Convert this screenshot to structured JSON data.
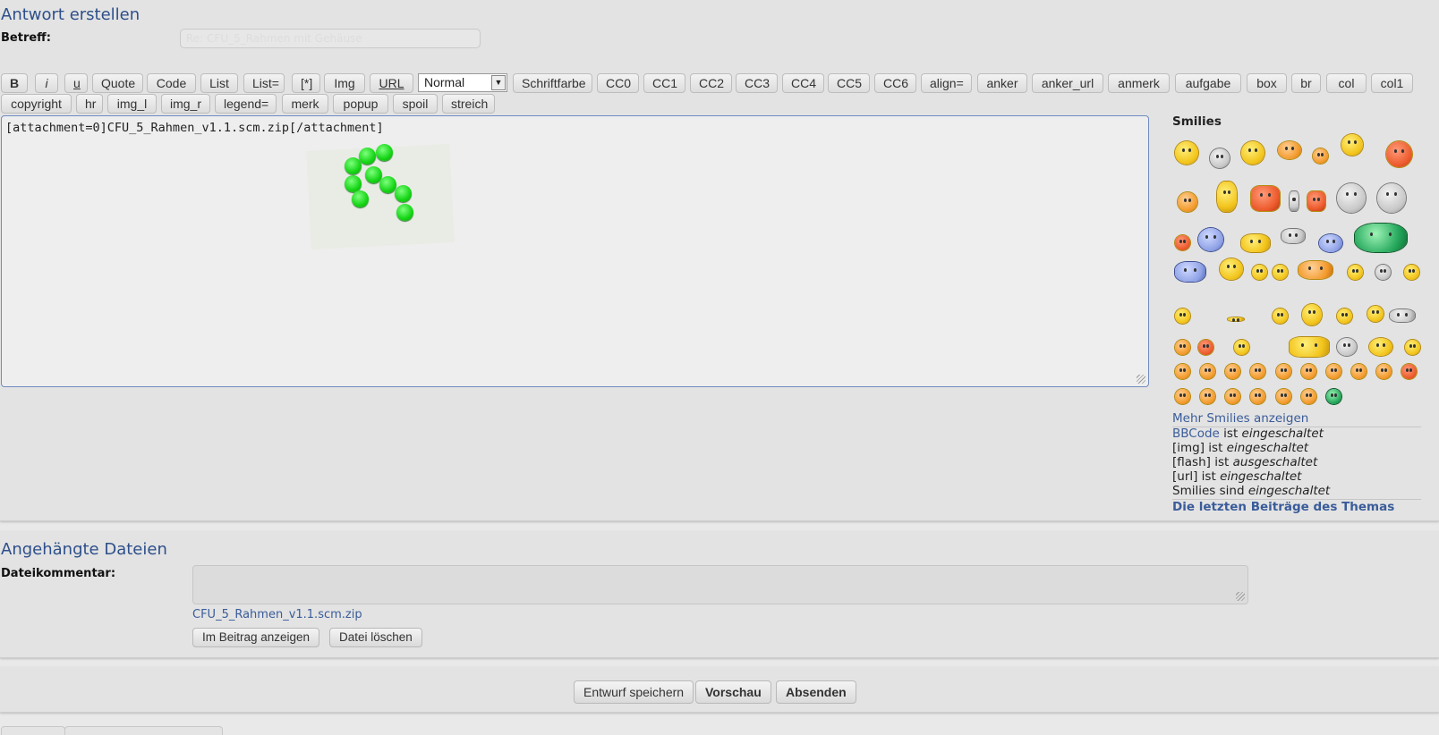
{
  "post": {
    "heading": "Antwort erstellen",
    "subject_label": "Betreff:",
    "subject_value": "Re: CFU_5_Rahmen mit Gehäuse"
  },
  "toolbar": {
    "buttons": [
      "B",
      "i",
      "u",
      "Quote",
      "Code",
      "List",
      "List=",
      "[*]",
      "Img",
      "URL"
    ],
    "font_size": "Normal",
    "buttons2": [
      "Schriftfarbe",
      "CC0",
      "CC1",
      "CC2",
      "CC3",
      "CC4",
      "CC5",
      "CC6",
      "align=",
      "anker",
      "anker_url",
      "anmerk",
      "aufgabe",
      "box",
      "br",
      "col",
      "col1"
    ],
    "row2": [
      "copyright",
      "hr",
      "img_l",
      "img_r",
      "legend=",
      "merk",
      "popup",
      "spoil",
      "streich"
    ]
  },
  "editor": {
    "content": "[attachment=0]CFU_5_Rahmen_v1.1.scm.zip[/attachment]"
  },
  "sidebar": {
    "smilies_title": "Smilies",
    "more_smilies": "Mehr Smilies anzeigen",
    "bbcode_link": "BBCode",
    "bbcode_rest": "ist",
    "bbcode_state": "eingeschaltet",
    "img_pre": "[img] ist",
    "img_state": "eingeschaltet",
    "flash_pre": "[flash] ist",
    "flash_state": "ausgeschaltet",
    "url_pre": "[url] ist",
    "url_state": "eingeschaltet",
    "smilies_pre": "Smilies sind",
    "smilies_state": "eingeschaltet",
    "last_posts": "Die letzten Beiträge des Themas"
  },
  "attachments": {
    "heading": "Angehängte Dateien",
    "comment_label": "Dateikommentar:",
    "file_name": "CFU_5_Rahmen_v1.1.scm.zip",
    "show_in_post": "Im Beitrag anzeigen",
    "delete_file": "Datei löschen"
  },
  "actions": {
    "save_draft": "Entwurf speichern",
    "preview": "Vorschau",
    "submit": "Absenden"
  },
  "colors": {
    "link": "#3a5c9a",
    "heading": "#2d4f8a",
    "editor_border": "#6f8cc1",
    "pasted_dots": "#14d414"
  }
}
